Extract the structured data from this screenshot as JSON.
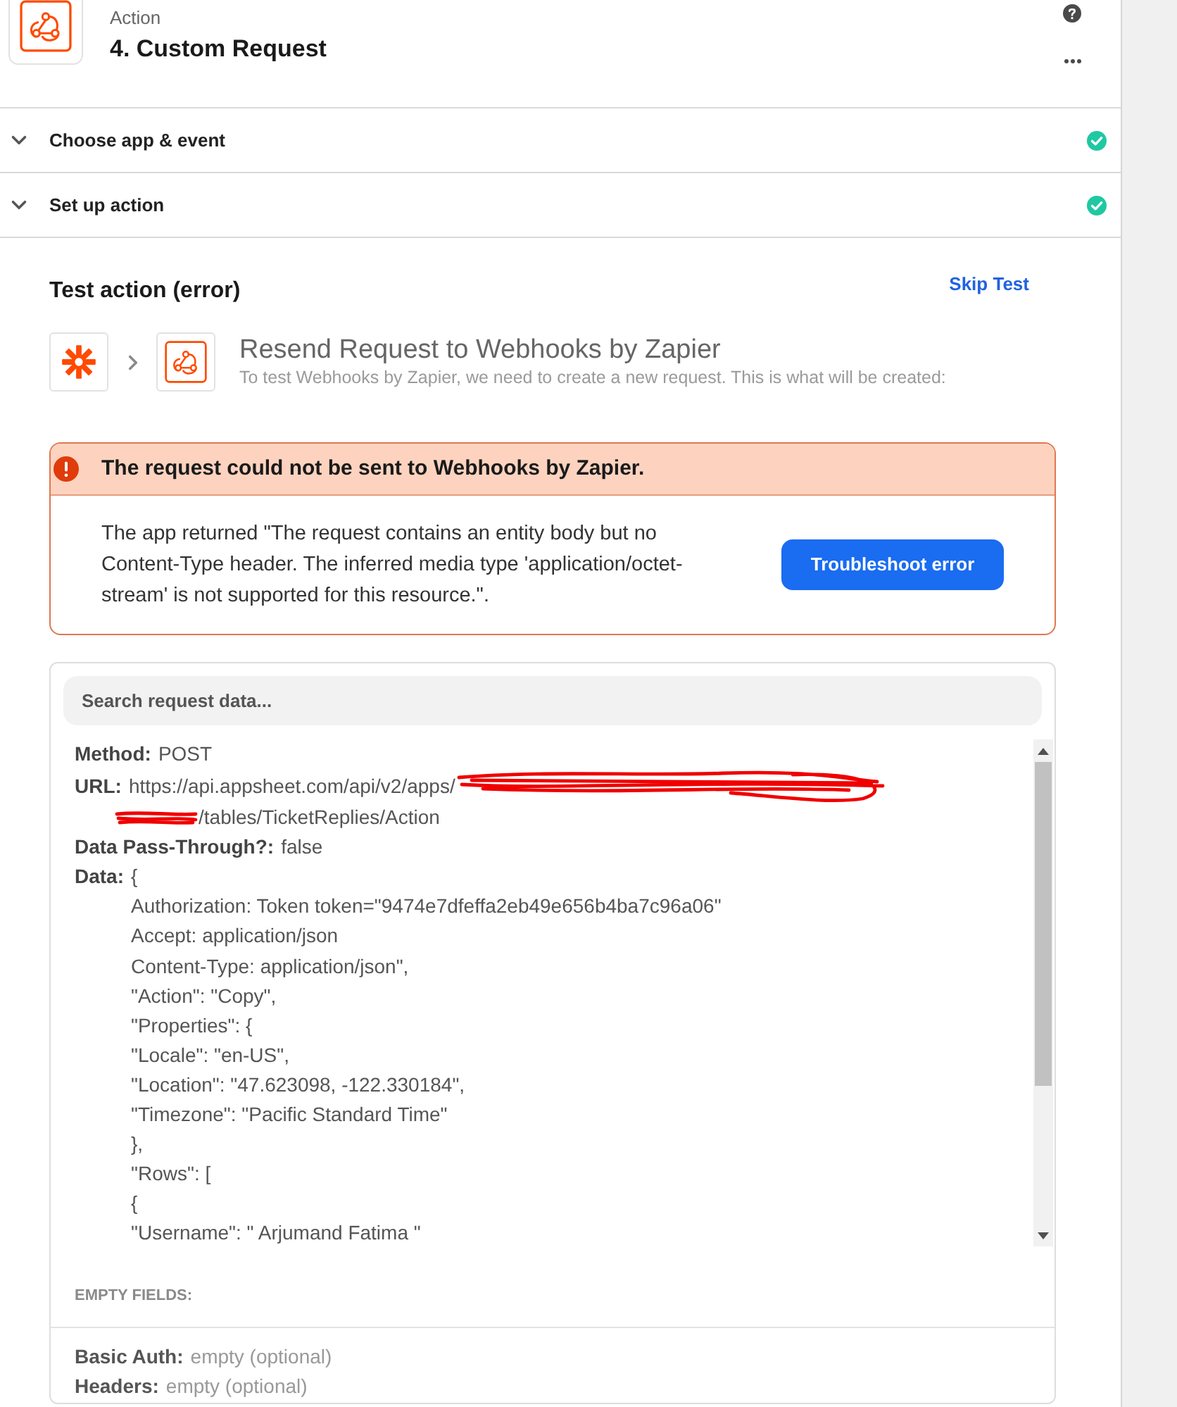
{
  "header": {
    "kicker": "Action",
    "title": "4. Custom Request"
  },
  "steps": [
    {
      "label": "Choose app & event",
      "expanded": false,
      "complete": true
    },
    {
      "label": "Set up action",
      "expanded": false,
      "complete": true
    }
  ],
  "test": {
    "title": "Test action (error)",
    "skip_link": "Skip Test",
    "request": {
      "title": "Resend Request to Webhooks by Zapier",
      "subtitle": "To test Webhooks by Zapier, we need to create a new request. This is what will be created:"
    }
  },
  "error": {
    "title": "The request could not be sent to Webhooks by Zapier.",
    "message": "The app returned \"The request contains an entity body but no Content-Type header. The inferred media type 'application/octet-stream' is not supported for this resource.\".",
    "button": "Troubleshoot error"
  },
  "request_data": {
    "search": {
      "placeholder": "Search request data..."
    },
    "fields": [
      {
        "label": "Method:",
        "value": "POST"
      },
      {
        "label": "URL:",
        "value": "https://api.appsheet.com/api/v2/apps/",
        "continuation": "/tables/TicketReplies/Action",
        "redacted": true
      },
      {
        "label": "Data Pass-Through?:",
        "value": "false"
      },
      {
        "label": "Data:",
        "value": "{",
        "lines": [
          "Authorization: Token token=\"9474e7dfeffa2eb49e656b4ba7c96a06\"",
          "Accept: application/json",
          "Content-Type: application/json\",",
          "\"Action\": \"Copy\",",
          "\"Properties\": {",
          "\"Locale\": \"en-US\",",
          "\"Location\": \"47.623098, -122.330184\",",
          "\"Timezone\": \"Pacific Standard Time\"",
          "},",
          "\"Rows\": [",
          "{",
          "\"Username\": \" Arjumand Fatima \""
        ]
      }
    ],
    "empty_fields": {
      "heading": "EMPTY FIELDS:",
      "items": [
        {
          "label": "Basic Auth:",
          "value": "empty (optional)"
        },
        {
          "label": "Headers:",
          "value": "empty (optional)"
        }
      ]
    }
  }
}
